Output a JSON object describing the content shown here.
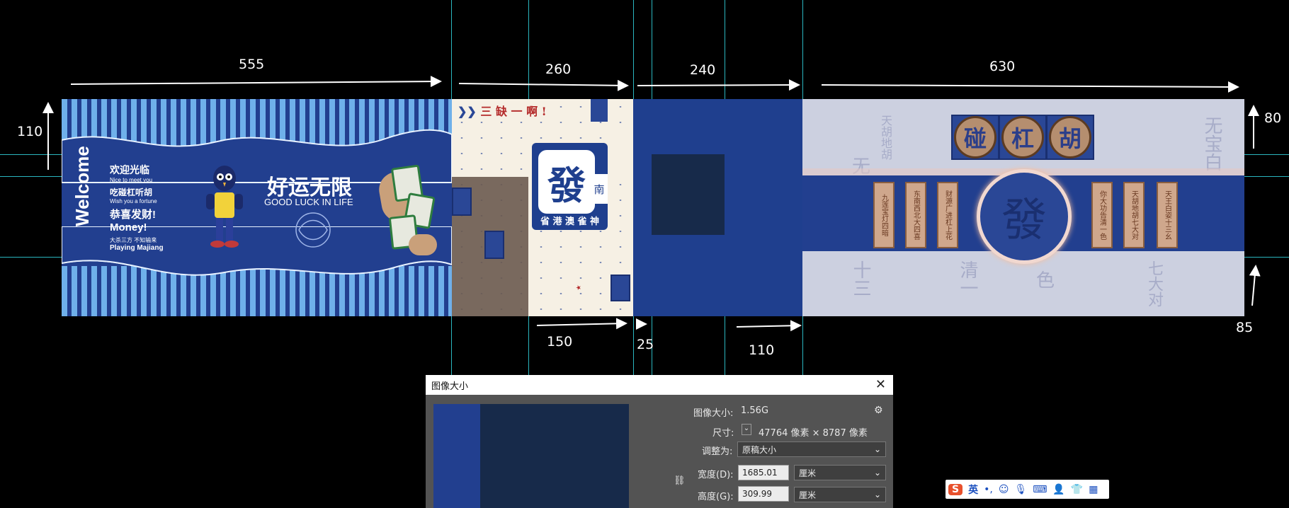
{
  "dimensions": {
    "top_555": "555",
    "top_260": "260",
    "top_240": "240",
    "top_630": "630",
    "left_110": "110",
    "right_80": "80",
    "right_85": "85",
    "bottom_150": "150",
    "bottom_25": "25",
    "bottom_110": "110"
  },
  "panel_a": {
    "welcome": "Welcome",
    "line1": "欢迎光临",
    "line1_en": "Nice to meet you",
    "line2": "吃碰杠听胡",
    "line2_en": "Wish you a fortune",
    "line3": "恭喜发财!",
    "line3_en": "Money!",
    "line4": "大杀三方 不知输来",
    "line4_en": "Playing Majiang",
    "slogan": "好运无限",
    "slogan_en": "GOOD LUCK IN LIFE"
  },
  "panel_b": {
    "top_text": "三 缺 一 啊 !",
    "fa": "發",
    "side_char": "南",
    "bottom_text": "省 港 澳 雀 神"
  },
  "panel_d": {
    "coins": [
      "碰",
      "杠",
      "胡"
    ],
    "fa": "發",
    "slips_left": [
      "九莲宝灯四暗",
      "东南西北大四喜",
      "财源广进杠上花"
    ],
    "slips_right": [
      "你大功告清一色",
      "天胡地胡七大对",
      "天王白姿十三幺"
    ],
    "ghost_text": [
      "天胡地胡",
      "无",
      "无宝白",
      "十三",
      "清一",
      "色",
      "七大对"
    ]
  },
  "dialog": {
    "title": "图像大小",
    "close": "✕",
    "size_label": "图像大小:",
    "size_value": "1.56G",
    "dims_label": "尺寸:",
    "dims_value": "47764 像素 × 8787 像素",
    "fit_label": "调整为:",
    "fit_value": "原稿大小",
    "width_label": "宽度(D):",
    "width_value": "1685.01",
    "width_unit": "厘米",
    "height_label": "高度(G):",
    "height_value": "309.99",
    "height_unit": "厘米"
  },
  "ime": {
    "logo": "S",
    "lang": "英"
  },
  "colors": {
    "navy": "#223f8f",
    "stripe": "#6fb0ea",
    "cream": "#f6f0e4",
    "guide": "#33d6e0",
    "dialog_bg": "#535353"
  }
}
